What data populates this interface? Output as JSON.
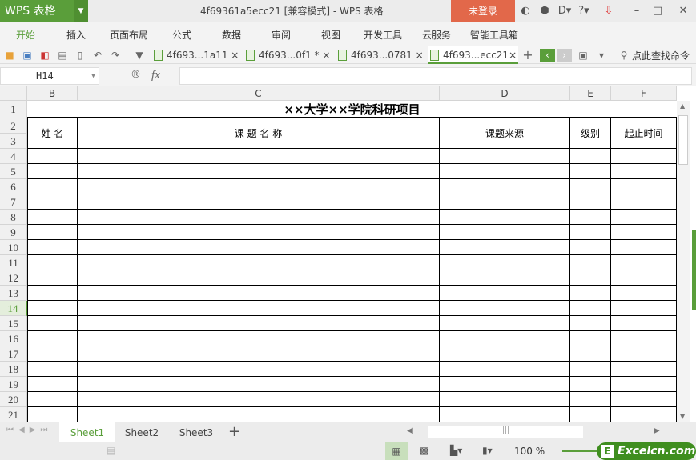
{
  "app": {
    "logo": "WPS 表格",
    "title": "4f69361a5ecc21 [兼容模式] - WPS 表格",
    "login": "未登录"
  },
  "menu": [
    "开始",
    "插入",
    "页面布局",
    "公式",
    "数据",
    "审阅",
    "视图",
    "开发工具",
    "云服务",
    "智能工具箱"
  ],
  "doc_tabs": [
    "4f693...1a11",
    "4f693...0f1 *",
    "4f693...0781",
    "4f693...ecc21"
  ],
  "search_label": "点此查找命令",
  "name_box": "H14",
  "fx": "fx",
  "columns": [
    "B",
    "C",
    "D",
    "E",
    "F"
  ],
  "rows": [
    "1",
    "2",
    "3",
    "4",
    "5",
    "6",
    "7",
    "8",
    "9",
    "10",
    "11",
    "12",
    "13",
    "14",
    "15",
    "16",
    "17",
    "18",
    "19",
    "20",
    "21"
  ],
  "selected_row": "14",
  "sheet": {
    "title": "××大学××学院科研项目",
    "headers": [
      "姓 名",
      "课 题 名 称",
      "课题来源",
      "级别",
      "起止时间"
    ]
  },
  "sheets": [
    "Sheet1",
    "Sheet2",
    "Sheet3"
  ],
  "active_sheet": "Sheet1",
  "zoom": "100 %",
  "watermark": "Excelcn.com",
  "colors": {
    "accent": "#5a9e3a",
    "login": "#e2684a"
  }
}
